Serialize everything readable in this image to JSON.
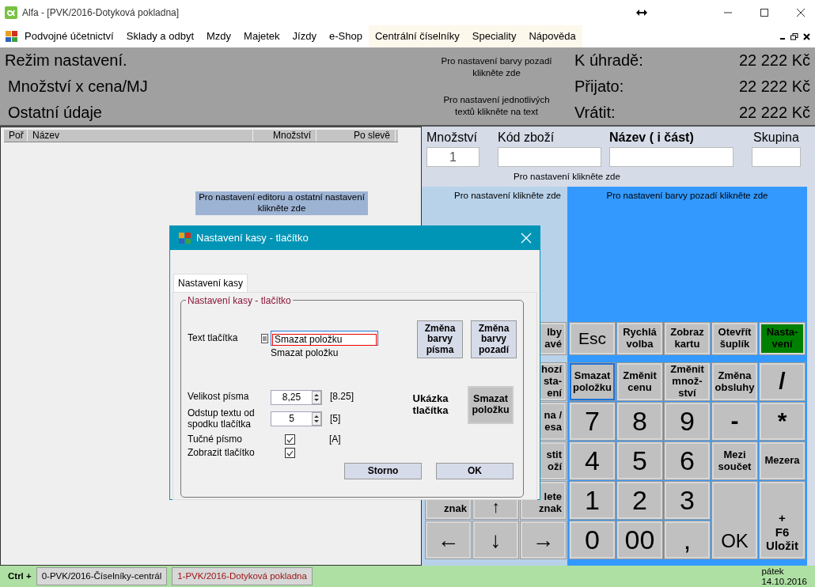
{
  "window": {
    "title": "Alfa - [PVK/2016-Dotyková pokladna]"
  },
  "menu": [
    {
      "label": "Podvojné účetnictví",
      "highlighted": false
    },
    {
      "label": "Sklady a odbyt",
      "highlighted": false
    },
    {
      "label": "Mzdy",
      "highlighted": false
    },
    {
      "label": "Majetek",
      "highlighted": false
    },
    {
      "label": "Jízdy",
      "highlighted": false
    },
    {
      "label": "e-Shop",
      "highlighted": false
    },
    {
      "label": "Centrální číselníky",
      "highlighted": true
    },
    {
      "label": "Speciality",
      "highlighted": true
    },
    {
      "label": "Nápověda",
      "highlighted": true
    }
  ],
  "header": {
    "lines": [
      "Režim nastavení.",
      "Množství x cena/MJ",
      "Ostatní údaje"
    ],
    "notes": [
      "Pro nastavení barvy pozadí klikněte zde",
      "Pro nastavení jednotlivých textů klikněte na text"
    ],
    "totals": [
      {
        "label": "K úhradě:",
        "value": "22 222 Kč"
      },
      {
        "label": "Přijato:",
        "value": "22 222 Kč"
      },
      {
        "label": "Vrátit:",
        "value": "22 222 Kč"
      }
    ]
  },
  "list": {
    "columns": [
      "Poř",
      "Název",
      "Množství",
      "Po slevě"
    ],
    "note": "Pro nastavení editoru a ostatní nastavení klikněte zde"
  },
  "search": {
    "fields": [
      {
        "label": "Množství",
        "value": "1",
        "active": false
      },
      {
        "label": "Kód zboží",
        "active": false
      },
      {
        "label": "Název ( i část)",
        "active": true
      },
      {
        "label": "Skupina",
        "active": false
      }
    ],
    "note": "Pro nastavení klikněte zde"
  },
  "nav_panel": {
    "note": "Pro nastavení klikněte zde",
    "rows": [
      [
        {
          "text": "lby\navé"
        }
      ],
      [
        {
          "text": "hozí\nsta-\není"
        }
      ],
      [
        {
          "text": "na /\nesa"
        }
      ],
      [
        {
          "text": "stit\noží"
        }
      ],
      [
        {
          "text": "znak"
        },
        {
          "text": "↑",
          "kind": "arrow"
        },
        {
          "text": "lete\nznak"
        }
      ],
      [
        {
          "text": "←",
          "kind": "arrow"
        },
        {
          "text": "↓",
          "kind": "arrow"
        },
        {
          "text": "→",
          "kind": "arrow"
        }
      ]
    ]
  },
  "keypad": {
    "note": "Pro nastavení barvy pozadí klikněte zde",
    "top_row": [
      {
        "text": "Esc",
        "kind": "large",
        "selected": false,
        "color": "#c0c0c0"
      },
      {
        "text": "Rychlá\nvolba",
        "kind": "word",
        "selected": false,
        "color": "#c0c0c0"
      },
      {
        "text": "Zobraz\nkartu",
        "kind": "word",
        "selected": false,
        "color": "#c0c0c0"
      },
      {
        "text": "Otevřít\nšuplík",
        "kind": "word",
        "selected": false,
        "color": "#c0c0c0"
      },
      {
        "text": "Nasta-\nvení",
        "kind": "word",
        "selected": false,
        "color": "#008000"
      }
    ],
    "keys": [
      {
        "text": "Smazat\npoložku",
        "kind": "word",
        "selected": true
      },
      {
        "text": "Změnit\ncenu",
        "kind": "word",
        "selected": false
      },
      {
        "text": "Změnit\nmnož-\nství",
        "kind": "word",
        "selected": false
      },
      {
        "text": "Změna\nobsluhy",
        "kind": "word",
        "selected": false
      },
      {
        "text": "/",
        "kind": "symbol",
        "selected": false
      },
      {
        "text": "7",
        "kind": "digit",
        "selected": false
      },
      {
        "text": "8",
        "kind": "digit",
        "selected": false
      },
      {
        "text": "9",
        "kind": "digit",
        "selected": false
      },
      {
        "text": "-",
        "kind": "symbol",
        "selected": false
      },
      {
        "text": "*",
        "kind": "symbol",
        "selected": false
      },
      {
        "text": "4",
        "kind": "digit",
        "selected": false
      },
      {
        "text": "5",
        "kind": "digit",
        "selected": false
      },
      {
        "text": "6",
        "kind": "digit",
        "selected": false
      },
      {
        "text": "Mezi\nsoučet",
        "kind": "word",
        "selected": false
      },
      {
        "text": "Mezera",
        "kind": "word",
        "selected": false
      },
      {
        "text": "1",
        "kind": "digit",
        "selected": false
      },
      {
        "text": "2",
        "kind": "digit",
        "selected": false
      },
      {
        "text": "3",
        "kind": "digit",
        "selected": false
      },
      {
        "text": "0",
        "kind": "digit",
        "selected": false
      },
      {
        "text": "00",
        "kind": "digit",
        "selected": false
      },
      {
        "text": ",",
        "kind": "digit",
        "selected": false
      },
      {
        "text": "OK",
        "kind": "tall-digit",
        "selected": false
      },
      {
        "text": "+\nF6\nUložit",
        "kind": "tall-word",
        "selected": false
      }
    ]
  },
  "dialog": {
    "title": "Nastavení kasy - tlačítko",
    "tab": {
      "label": "Nastavení kasy",
      "selected": true
    },
    "group": "Nastavení kasy - tlačítko",
    "text_label": "Text tlačítka",
    "text_value": "Smazat položku",
    "text_preview": "Smazat položku",
    "color_buttons": [
      "Změna\nbarvy\npísma",
      "Změna\nbarvy\npozadí"
    ],
    "spinners": [
      {
        "label": "Velikost písma",
        "value": "8,25",
        "note": "[8.25]"
      },
      {
        "label": "Odstup textu od\nspodku tlačítka",
        "value": "5",
        "note": "[5]"
      }
    ],
    "checks": [
      {
        "label": "Tučné písmo",
        "checked": true,
        "note": "[A]"
      },
      {
        "label": "Zobrazit tlačítko",
        "checked": true
      }
    ],
    "sample_label": "Ukázka\ntlačítka",
    "sample_button": "Smazat\npoložku",
    "buttons": [
      "Storno",
      "OK"
    ]
  },
  "status_bar": {
    "prefix": "Ctrl +",
    "tabs": [
      {
        "label": "0-PVK/2016-Číselníky-centrál",
        "selected": false
      },
      {
        "label": "1-PVK/2016-Dotyková pokladna",
        "selected": true
      }
    ],
    "day": "pátek",
    "date": "14.10.2016"
  }
}
